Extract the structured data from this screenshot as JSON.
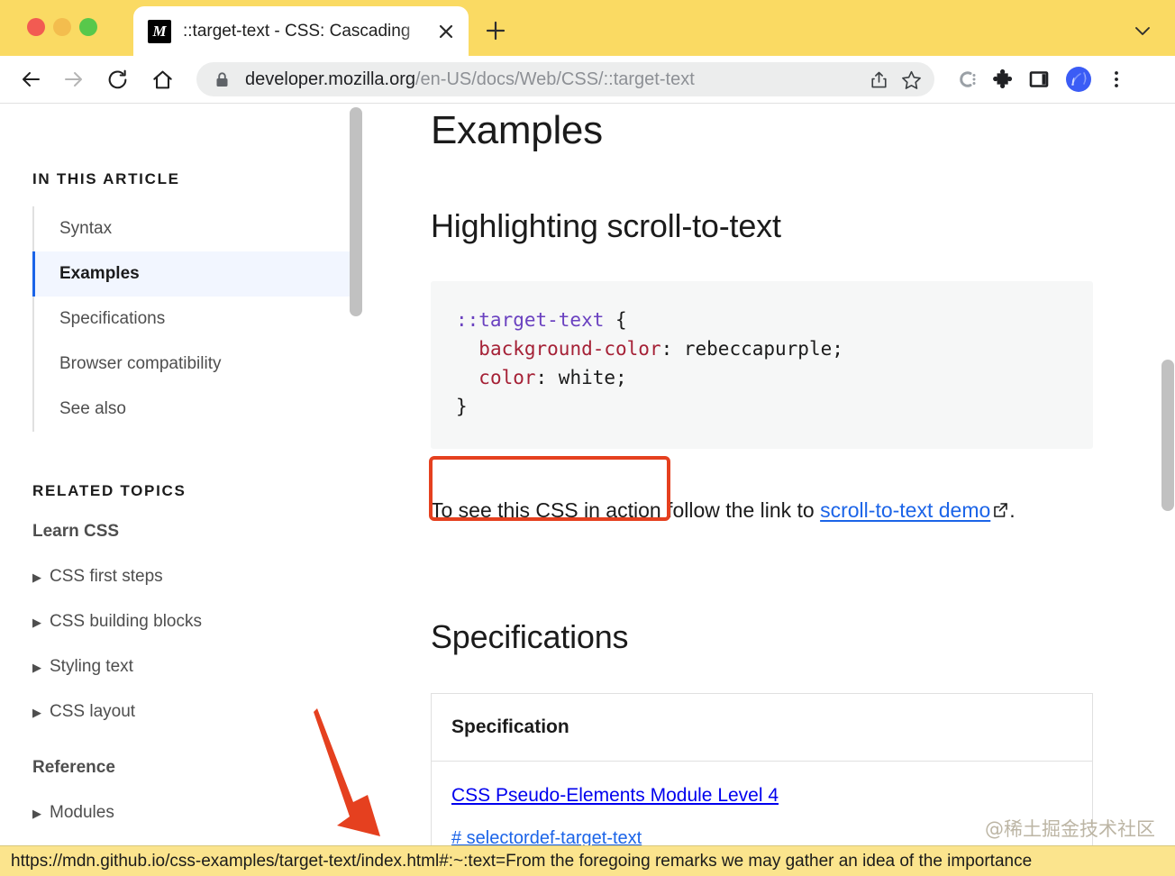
{
  "browser": {
    "tab": {
      "title": "::target-text - CSS: Cascading",
      "favicon_letter": "M",
      "favicon_name": "mdn-favicon",
      "close_label": "✕"
    },
    "new_tab_label": "+",
    "tabstrip_expand_icon": "chevron-down-icon",
    "toolbar": {
      "back_icon": "back-arrow-icon",
      "forward_icon": "forward-arrow-icon",
      "reload_icon": "reload-icon",
      "home_icon": "home-icon",
      "lock_icon": "lock-icon",
      "url_domain": "developer.mozilla.org",
      "url_path": "/en-US/docs/Web/CSS/::target-text",
      "share_icon": "share-icon",
      "bookmark_icon": "star-icon",
      "colorzilla_icon": "colorzilla-icon",
      "extensions_icon": "puzzle-piece-icon",
      "sidepanel_icon": "side-panel-icon",
      "profile_icon": "profile-avatar-icon",
      "menu_icon": "three-dot-menu-icon"
    },
    "status_bar_url": "https://mdn.github.io/css-examples/target-text/index.html#:~:text=From the foregoing remarks we may gather an idea of the importance"
  },
  "sidebar": {
    "in_this_article_heading": "IN THIS ARTICLE",
    "toc": [
      {
        "label": "Syntax",
        "active": false
      },
      {
        "label": "Examples",
        "active": true
      },
      {
        "label": "Specifications",
        "active": false
      },
      {
        "label": "Browser compatibility",
        "active": false
      },
      {
        "label": "See also",
        "active": false
      }
    ],
    "related_topics_heading": "RELATED TOPICS",
    "groups": [
      {
        "title": "Learn CSS",
        "items": [
          "CSS first steps",
          "CSS building blocks",
          "Styling text",
          "CSS layout"
        ]
      },
      {
        "title": "Reference",
        "items": [
          "Modules"
        ]
      }
    ],
    "caret_glyph": "▶"
  },
  "content": {
    "h1_examples": "Examples",
    "h2_highlighting": "Highlighting scroll-to-text",
    "code": {
      "line1_selector": "::target-text",
      "line1_brace": " {",
      "line2_prop": "background-color",
      "line2_value": ": rebeccapurple;",
      "line3_prop": "color",
      "line3_value": ": white;",
      "line4_brace": "}"
    },
    "demo_text_before": "To see this CSS in action follow the link to ",
    "demo_link_text": "scroll-to-text demo",
    "demo_external_icon": "external-link-icon",
    "demo_text_after": ".",
    "h2_specifications": "Specifications",
    "spec_table": {
      "header": "Specification",
      "rows": [
        {
          "title": "CSS Pseudo-Elements Module Level 4",
          "anchor": "# selectordef-target-text"
        }
      ]
    }
  },
  "annotations": {
    "highlight_box_color": "#e5401f",
    "arrow_color": "#e5401f",
    "watermark": "@稀土掘金技术社区"
  }
}
